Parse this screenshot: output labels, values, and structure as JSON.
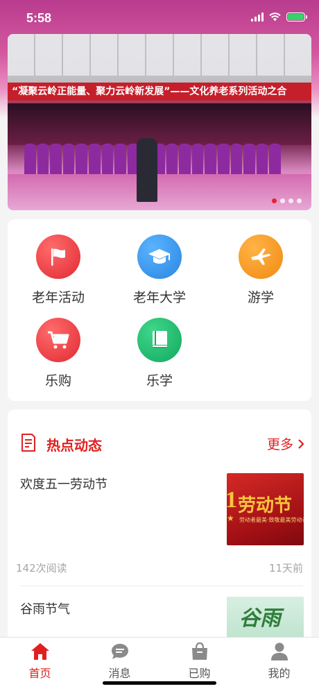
{
  "status_bar": {
    "time": "5:58"
  },
  "banner": {
    "headline": "“凝聚云岭正能量、聚力云岭新发展”——文化养老系列活动之合",
    "slide_count": 4,
    "active_slide": 1
  },
  "menu": {
    "items": [
      {
        "label": "老年活动",
        "icon": "flag-icon",
        "color": "#e8303a"
      },
      {
        "label": "老年大学",
        "icon": "graduation-cap-icon",
        "color": "#2f8fe6"
      },
      {
        "label": "游学",
        "icon": "airplane-icon",
        "color": "#f3901c"
      },
      {
        "label": "乐购",
        "icon": "shopping-cart-icon",
        "color": "#e8303a"
      },
      {
        "label": "乐学",
        "icon": "book-icon",
        "color": "#1fb36a"
      }
    ]
  },
  "news": {
    "title": "热点动态",
    "more": "更多",
    "items": [
      {
        "title": "欢度五一劳动节",
        "reads": "142次阅读",
        "time": "11天前",
        "thumb_text": "劳动节",
        "thumb_digit": "1",
        "thumb_sub": "劳动者最美·致敬最美劳动者"
      },
      {
        "title": "谷雨节气",
        "thumb_text": "谷雨"
      }
    ]
  },
  "tabbar": {
    "items": [
      {
        "label": "首页",
        "icon": "home-icon",
        "active": true
      },
      {
        "label": "消息",
        "icon": "chat-bubble-icon",
        "active": false
      },
      {
        "label": "已购",
        "icon": "shopping-bag-icon",
        "active": false
      },
      {
        "label": "我的",
        "icon": "user-icon",
        "active": false
      }
    ]
  },
  "colors": {
    "accent": "#e02020",
    "background": "#f4f4f5"
  }
}
